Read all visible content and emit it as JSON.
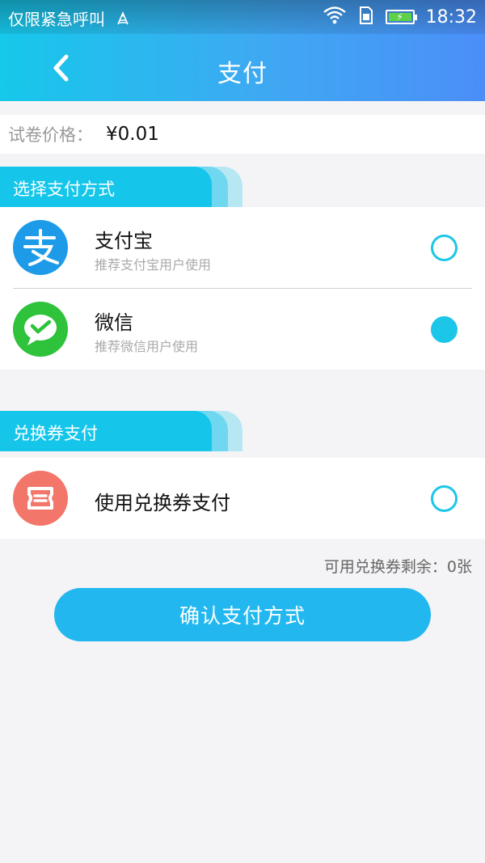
{
  "status_bar": {
    "carrier": "仅限紧急呼叫",
    "time": "18:32"
  },
  "header": {
    "title": "支付",
    "back_icon": "chevron-left-icon"
  },
  "price": {
    "label": "试卷价格：",
    "value": "¥0.01"
  },
  "payment_section": {
    "title": "选择支付方式",
    "options": [
      {
        "name": "支付宝",
        "sub": "推荐支付宝用户使用",
        "icon": "alipay-icon",
        "color": "#1e9be8",
        "selected": false
      },
      {
        "name": "微信",
        "sub": "推荐微信用户使用",
        "icon": "wechat-icon",
        "color": "#2ec33b",
        "selected": true
      }
    ]
  },
  "coupon_section": {
    "title": "兑换券支付",
    "option": {
      "name": "使用兑换券支付",
      "icon": "coupon-icon",
      "color": "#f27669",
      "selected": false
    },
    "remaining": "可用兑换券剩余：0张"
  },
  "confirm_button": "确认支付方式",
  "colors": {
    "accent": "#1cc6e8",
    "button": "#22b8ef",
    "header_start": "#16c8ea",
    "header_end": "#4b8ef8"
  }
}
